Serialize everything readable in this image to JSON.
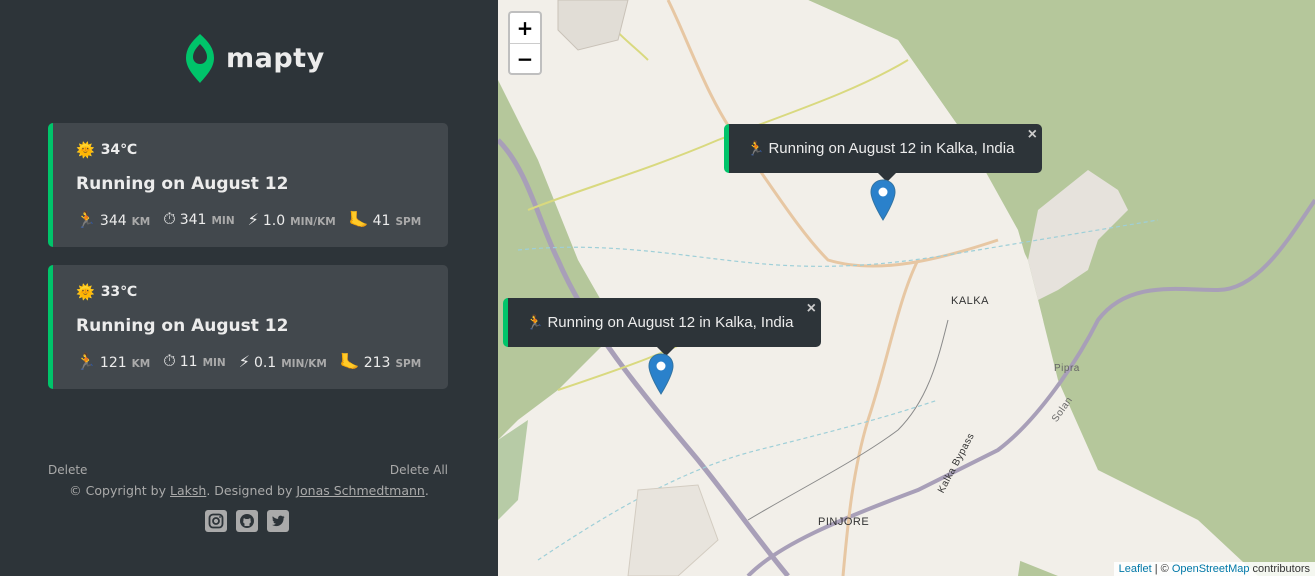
{
  "app": {
    "name": "mapty"
  },
  "workouts": [
    {
      "temperature": "34℃",
      "title": "Running on August 12",
      "distance": "344",
      "distance_unit": "KM",
      "duration": "341",
      "duration_unit": "MIN",
      "pace": "1.0",
      "pace_unit": "MIN/KM",
      "cadence": "41",
      "cadence_unit": "SPM"
    },
    {
      "temperature": "33℃",
      "title": "Running on August 12",
      "distance": "121",
      "distance_unit": "KM",
      "duration": "11",
      "duration_unit": "MIN",
      "pace": "0.1",
      "pace_unit": "MIN/KM",
      "cadence": "213",
      "cadence_unit": "SPM"
    }
  ],
  "actions": {
    "delete": "Delete",
    "delete_all": "Delete All"
  },
  "footer": {
    "copyright_prefix": "© Copyright by ",
    "author": "Laksh",
    "designed_by": ". Designed by ",
    "designer": "Jonas Schmedtmann",
    "suffix": "."
  },
  "socials": [
    "instagram-icon",
    "github-icon",
    "twitter-icon"
  ],
  "map": {
    "zoom_in": "+",
    "zoom_out": "−",
    "popups": [
      {
        "text": "Running on August 12 in Kalka, India"
      },
      {
        "text": "Running on August 12 in Kalka, India"
      }
    ],
    "labels": {
      "kalka": "KALKA",
      "pinjore": "PINJORE",
      "pipra": "Pipra",
      "bypass": "Kalka Bypass",
      "solan": "Solan"
    },
    "attribution": {
      "leaflet": "Leaflet",
      "sep": " | © ",
      "osm": "OpenStreetMap",
      "contributors": " contributors"
    }
  },
  "colors": {
    "accent": "#00c46a",
    "sidebar": "#2d3439",
    "card": "#42484d"
  }
}
